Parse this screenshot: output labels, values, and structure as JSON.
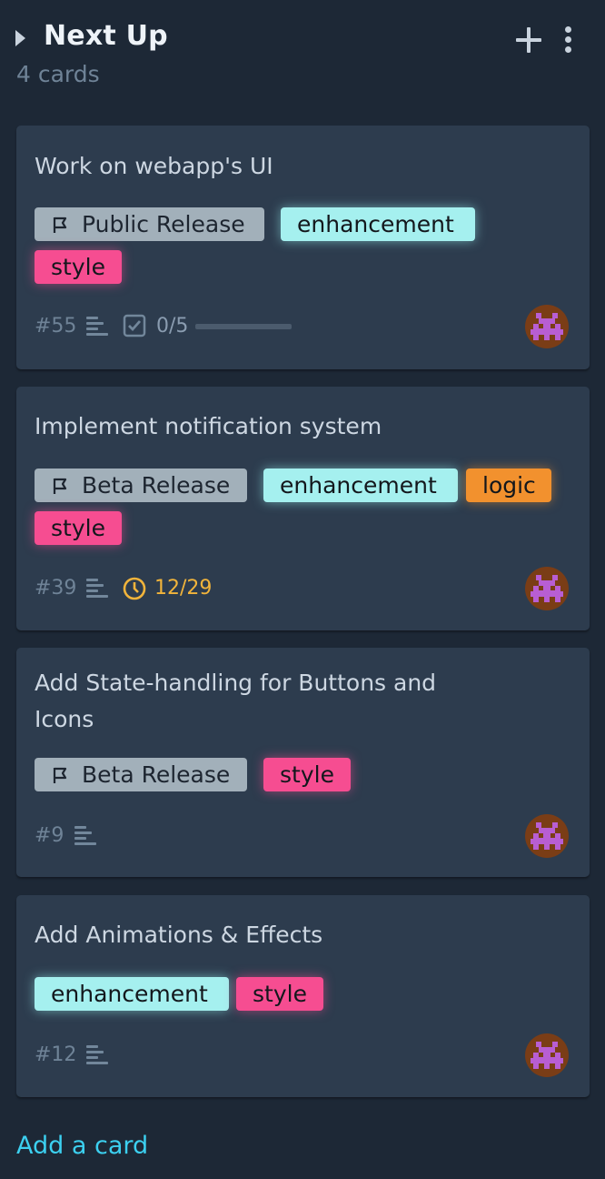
{
  "column": {
    "title": "Next Up",
    "count_text": "4 cards",
    "add_card_label": "Add a card"
  },
  "colors": {
    "background": "#1d2836",
    "card": "#2d3c4e",
    "milestone_label": "#a2b0ba",
    "enhancement_label": "#a5f0ef",
    "style_label": "#f64d91",
    "logic_label": "#f2912e",
    "due_warning": "#f1b43b",
    "link": "#3cd0f0"
  },
  "cards": [
    {
      "title": "Work on webapp's UI",
      "milestone": "Public Release",
      "labels": [
        "enhancement",
        "style"
      ],
      "number": "#55",
      "has_description": true,
      "checklist": "0/5",
      "checklist_progress": 0,
      "avatar": "pixel-invader-avatar"
    },
    {
      "title": "Implement notification system",
      "milestone": "Beta Release",
      "labels": [
        "enhancement",
        "logic",
        "style"
      ],
      "number": "#39",
      "has_description": true,
      "due_date": "12/29",
      "avatar": "pixel-invader-avatar"
    },
    {
      "title": "Add State-handling for Buttons and Icons",
      "milestone": "Beta Release",
      "labels": [
        "style"
      ],
      "number": "#9",
      "has_description": true,
      "avatar": "pixel-invader-avatar"
    },
    {
      "title": "Add Animations & Effects",
      "labels": [
        "enhancement",
        "style"
      ],
      "number": "#12",
      "has_description": true,
      "avatar": "pixel-invader-avatar"
    }
  ]
}
